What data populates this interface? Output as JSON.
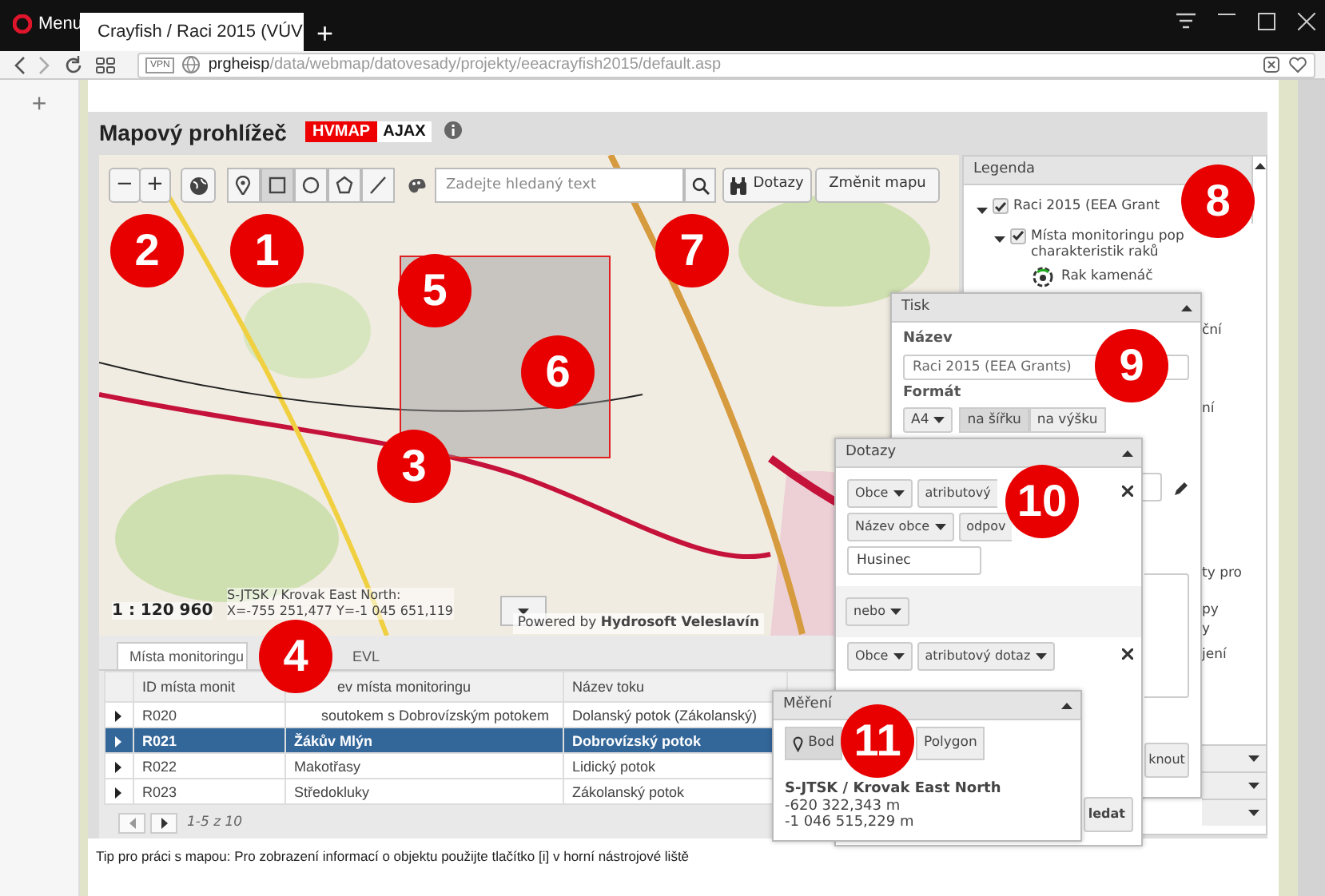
{
  "browser": {
    "menu": "Menu",
    "tab_title": "Crayfish / Raci 2015 (VÚV",
    "new_tab": "+",
    "vpn": "VPN",
    "url_host": "prgheisp",
    "url_path": "/data/webmap/datovesady/projekty/eeacrayfish2015/default.asp",
    "sidebar_add": "+"
  },
  "header": {
    "title": "Mapový prohlížeč",
    "badges": [
      {
        "label": "HVMAP",
        "kind": "primary"
      },
      {
        "label": "AJAX",
        "kind": "plain"
      }
    ]
  },
  "map": {
    "zoom_out": "−",
    "zoom_in": "+",
    "tools": [
      {
        "kind": "pin",
        "selected": false
      },
      {
        "kind": "rect",
        "selected": true
      },
      {
        "kind": "circle",
        "selected": false
      },
      {
        "kind": "polygon",
        "selected": false
      },
      {
        "kind": "line",
        "selected": false
      }
    ],
    "search": {
      "placeholder": "Zadejte hledaný text"
    },
    "queries_button": "Dotazy",
    "change_map_button": "Změnit mapu",
    "scale": "1 : 120 960",
    "coordinates": [
      "S-JTSK / Krovak East North:",
      "X=-755 251,477 Y=-1 045 651,119"
    ],
    "credit": "Powered by **Hydrosoft Veleslavín**"
  },
  "legend": {
    "title": "Legenda",
    "tree": [
      {
        "label": "Raci 2015 (EEA Grant",
        "checked": true,
        "expanded": true,
        "children": [
          {
            "label": "Místa monitoringu pop charakteristik raků",
            "checked": true,
            "expanded": true,
            "children": [
              {
                "label": "Rak kamenáč",
                "kind": "symbol"
              },
              {
                "label": "ční",
                "kind": "cut"
              },
              {
                "label": "ní",
                "kind": "cut"
              },
              {
                "label": "ty pro",
                "kind": "cut"
              },
              {
                "label": "py",
                "kind": "cut"
              },
              {
                "label": "y",
                "kind": "cut"
              },
              {
                "label": "jení",
                "kind": "cut"
              }
            ]
          }
        ]
      }
    ]
  },
  "bottom_tabs": [
    {
      "label": "Místa monitoringu",
      "selected": true
    },
    {
      "label": "EVL",
      "selected": false
    }
  ],
  "table": {
    "columns": [
      "ID místa monit",
      "ev místa monitoringu",
      "Název toku"
    ],
    "rows": [
      {
        "cells": [
          "R020",
          "soutokem s Dobrovízským potokem",
          "Dolanský potok (Zákolanský)"
        ],
        "selected": false
      },
      {
        "cells": [
          "R021",
          "Žákův Mlýn",
          "Dobrovízský potok"
        ],
        "selected": true
      },
      {
        "cells": [
          "R022",
          "Makotřasy",
          "Lidický potok"
        ],
        "selected": false
      },
      {
        "cells": [
          "R023",
          "Středokluky",
          "Zákolanský potok"
        ],
        "selected": false
      }
    ],
    "pager": "1-5 z 10"
  },
  "tip": "Tip pro práci s mapou: Pro zobrazení informací o objektu použijte tlačítko [i] v horní nástrojové liště",
  "print_panel": {
    "title": "Tisk",
    "name_label": "Název",
    "name_value": "Raci 2015 (EEA Grants)",
    "format_label": "Formát",
    "paper": "A4",
    "orientations": [
      {
        "label": "na šířku",
        "selected": true
      },
      {
        "label": "na výšku",
        "selected": false
      }
    ],
    "button": "knout"
  },
  "query_panel": {
    "title": "Dotazy",
    "queries": [
      {
        "layer": "Obce",
        "type": "atributový",
        "field": "Název obce",
        "operator": "odpov",
        "value": "Husinec"
      },
      {
        "layer": "Obce",
        "type": "atributový dotaz"
      }
    ],
    "joiner": "nebo",
    "search_button": "ledat"
  },
  "measure_panel": {
    "title": "Měření",
    "modes": [
      {
        "kind": "point",
        "label": "Bod",
        "selected": true
      },
      {
        "kind": "polygon",
        "label": "Polygon",
        "selected": false
      }
    ],
    "crs": "S-JTSK / Krovak East North",
    "values": [
      "-620 322,343 m",
      "-1 046 515,229 m"
    ]
  },
  "annotations": [
    "8",
    "2",
    "1",
    "7",
    "5",
    "9",
    "6",
    "3",
    "10",
    "4",
    "11"
  ]
}
